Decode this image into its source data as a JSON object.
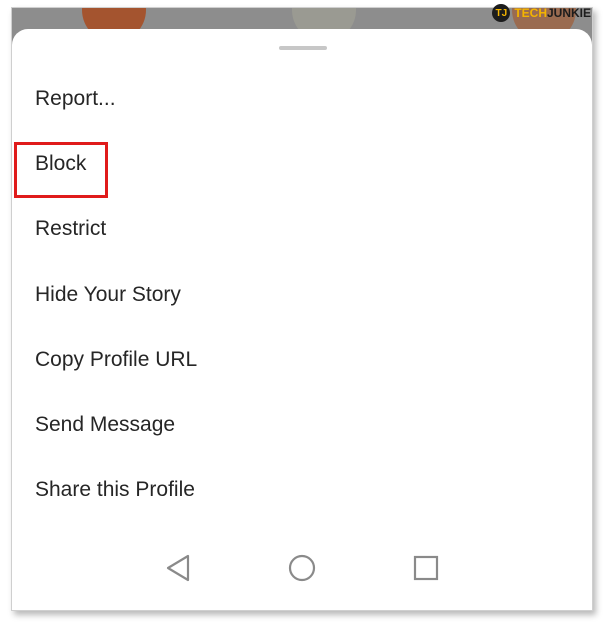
{
  "menu": {
    "items": [
      {
        "label": "Report..."
      },
      {
        "label": "Block"
      },
      {
        "label": "Restrict"
      },
      {
        "label": "Hide Your Story"
      },
      {
        "label": "Copy Profile URL"
      },
      {
        "label": "Send Message"
      },
      {
        "label": "Share this Profile"
      }
    ]
  },
  "highlight": {
    "item": "Block",
    "color": "#e01b1b"
  },
  "navbar": {
    "buttons": [
      {
        "icon": "back-triangle-icon"
      },
      {
        "icon": "home-circle-icon"
      },
      {
        "icon": "recents-square-icon"
      }
    ]
  },
  "watermark": {
    "mark": "TJ",
    "text_a": "TECH",
    "text_b": "JUNKIE"
  }
}
